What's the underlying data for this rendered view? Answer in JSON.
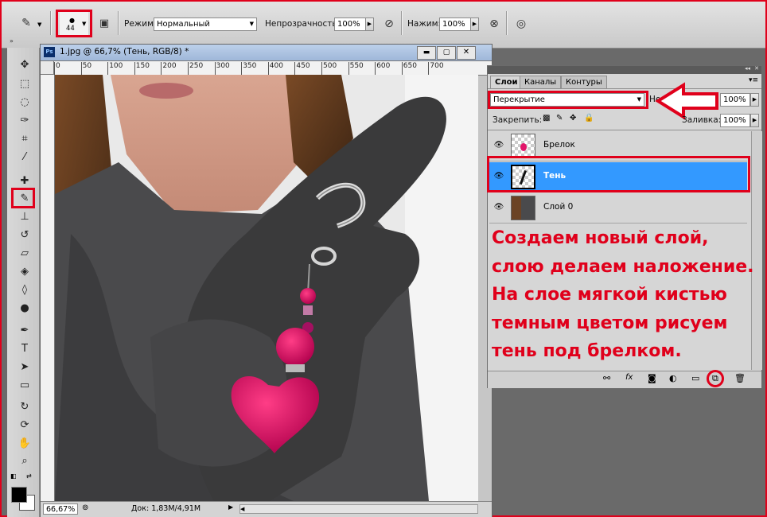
{
  "options_bar": {
    "brush_size": "44",
    "mode_label": "Режим:",
    "mode_value": "Нормальный",
    "opacity_label": "Непрозрачность:",
    "opacity_value": "100%",
    "pressure_label": "Нажим:",
    "pressure_value": "100%"
  },
  "document": {
    "title": "1.jpg @ 66,7% (Тень, RGB/8) *",
    "ruler_ticks": [
      "0",
      "50",
      "100",
      "150",
      "200",
      "250",
      "300",
      "350",
      "400",
      "450",
      "500",
      "550",
      "600",
      "650",
      "700"
    ],
    "zoom": "66,67%",
    "doc_size": "Док: 1,83M/4,91M"
  },
  "layers_panel": {
    "tabs": [
      "Слои",
      "Каналы",
      "Контуры"
    ],
    "blend_mode": "Перекрытие",
    "opacity_short": "Не",
    "opacity_value": "100%",
    "lock_label": "Закрепить:",
    "fill_label": "Заливка:",
    "fill_value": "100%",
    "layers": [
      {
        "name": "Брелок",
        "selected": false
      },
      {
        "name": "Тень",
        "selected": true
      },
      {
        "name": "Слой 0",
        "selected": false
      }
    ]
  },
  "annotation": {
    "lines": [
      "Создаем новый слой,",
      "слою делаем наложение.",
      "На слое мягкой кистью",
      "темным цветом рисуем",
      "тень под брелком."
    ]
  },
  "colors": {
    "accent_red": "#e0001b",
    "selection_blue": "#3399ff"
  }
}
